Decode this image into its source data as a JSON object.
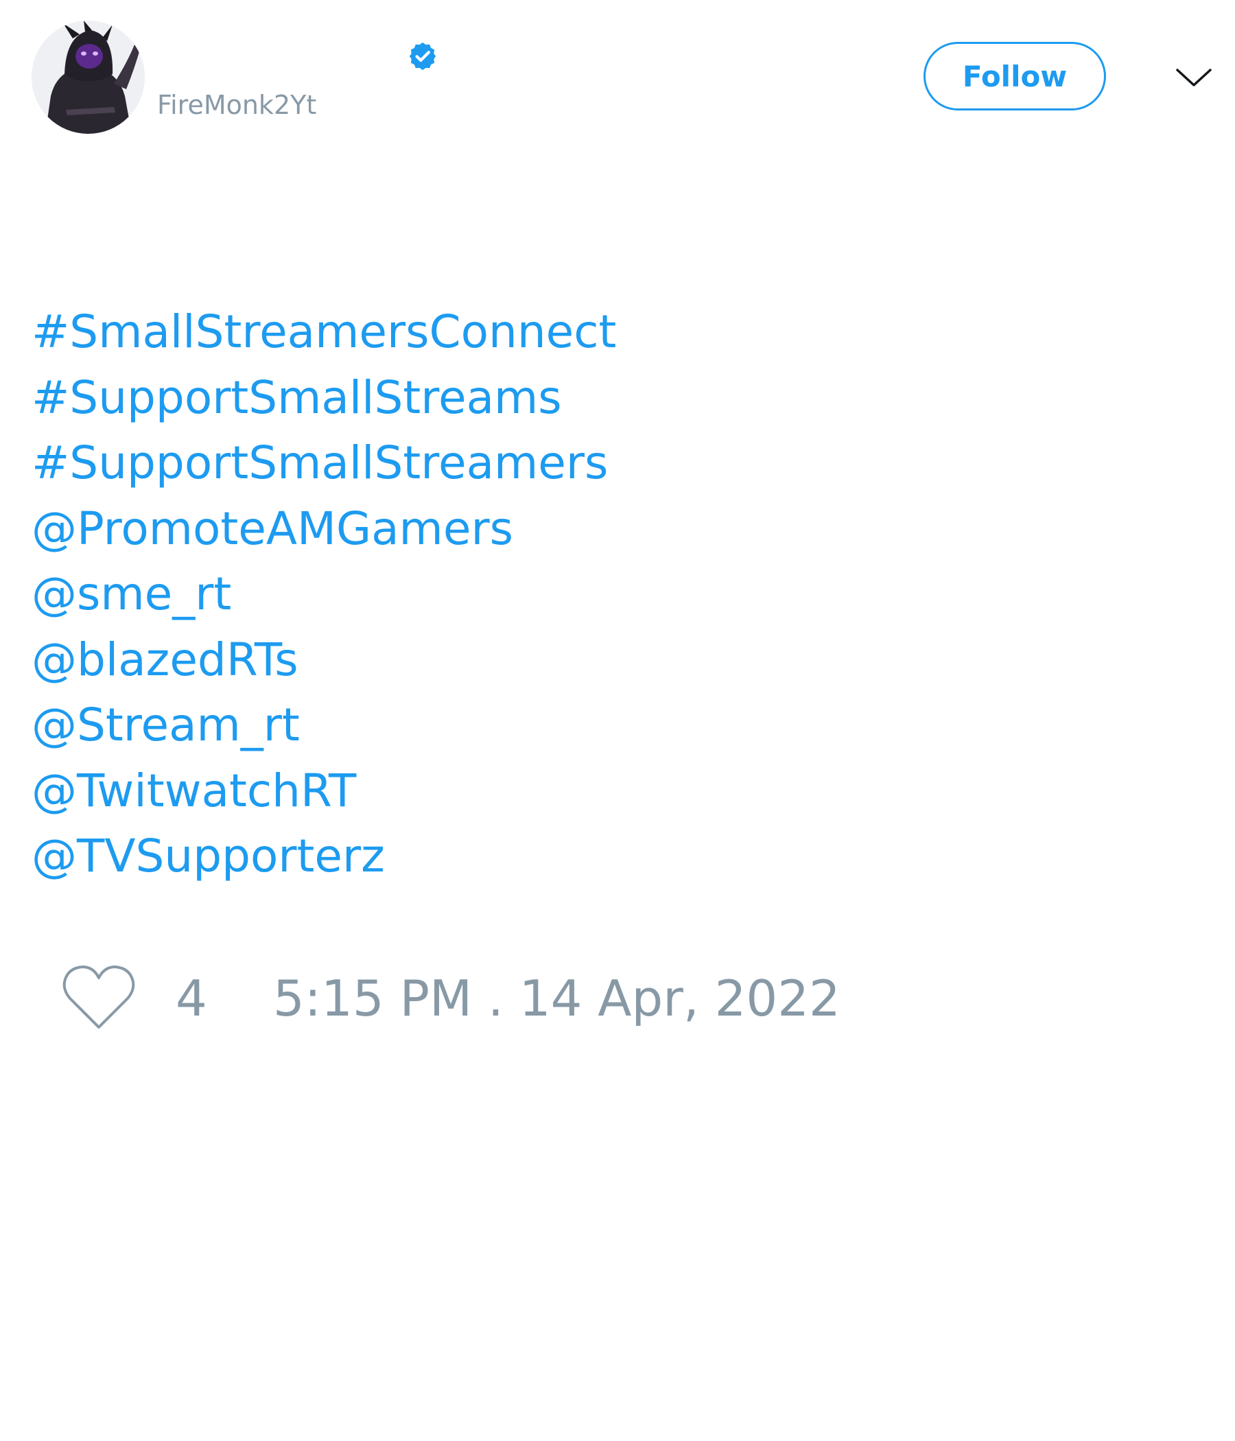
{
  "tweet": {
    "author": {
      "display_name": "",
      "handle": "FireMonk2Yt",
      "avatar_icon": "hooded-character-avatar",
      "verified_icon": "verified-badge-icon"
    },
    "follow_label": "Follow",
    "more_icon": "chevron-down-icon",
    "text_lines": [
      "#SmallStreamersConnect",
      "#SupportSmallStreams",
      "#SupportSmallStreamers",
      "@PromoteAMGamers",
      "@sme_rt",
      "@blazedRTs",
      "@Stream_rt",
      "@TwitwatchRT",
      "@TVSupporterz"
    ],
    "likes": "4",
    "like_icon": "heart-outline-icon",
    "timestamp": "5:15 PM . 14 Apr, 2022"
  },
  "colors": {
    "accent": "#1d9bf0",
    "muted": "#8899a6",
    "background": "#ffffff"
  }
}
